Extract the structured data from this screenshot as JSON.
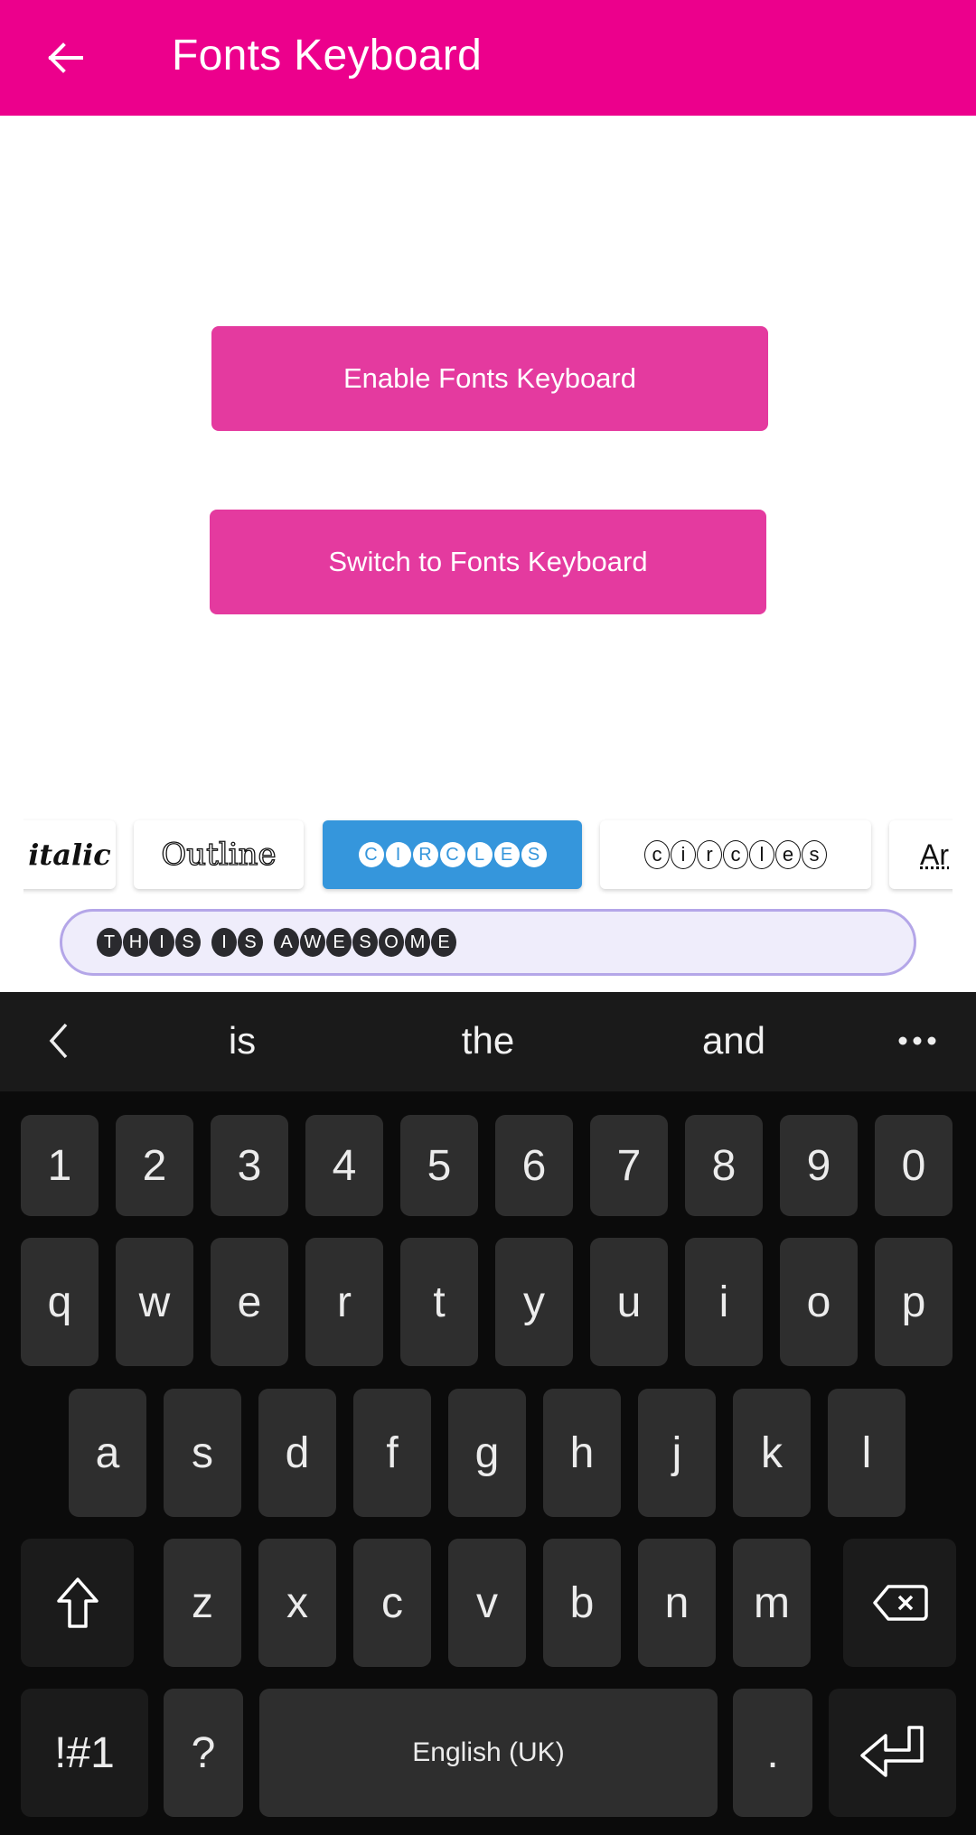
{
  "appbar": {
    "title": "Fonts Keyboard",
    "back_icon": "arrow-left-icon",
    "color": "#ec008c"
  },
  "main": {
    "enable_button": "Enable Fonts Keyboard",
    "switch_button": "Switch to Fonts Keyboard",
    "button_color": "#e43a9f"
  },
  "font_styles": {
    "selected_color": "#3596dc",
    "items": [
      {
        "label": "italic",
        "style": "italic"
      },
      {
        "label": "Outline",
        "style": "outline"
      },
      {
        "label": "CIRCLES",
        "style": "filled-circles",
        "selected": true
      },
      {
        "label": "circles",
        "style": "outline-circles"
      },
      {
        "label": "Ar",
        "style": "arrows"
      }
    ]
  },
  "preview_input": {
    "value": "THIS IS AWESOME"
  },
  "keyboard": {
    "suggestions": {
      "collapse_icon": "chevron-left-icon",
      "words": [
        "is",
        "the",
        "and"
      ],
      "more_icon": "more-horizontal-icon"
    },
    "rows": {
      "numbers": [
        "1",
        "2",
        "3",
        "4",
        "5",
        "6",
        "7",
        "8",
        "9",
        "0"
      ],
      "row1": [
        "q",
        "w",
        "e",
        "r",
        "t",
        "y",
        "u",
        "i",
        "o",
        "p"
      ],
      "row2": [
        "a",
        "s",
        "d",
        "f",
        "g",
        "h",
        "j",
        "k",
        "l"
      ],
      "row3": [
        "z",
        "x",
        "c",
        "v",
        "b",
        "n",
        "m"
      ]
    },
    "shift_icon": "shift-arrow-icon",
    "backspace_icon": "backspace-icon",
    "symbols_label": "!#1",
    "question_label": "?",
    "space_label": "English (UK)",
    "period_label": ".",
    "enter_icon": "enter-return-icon"
  }
}
